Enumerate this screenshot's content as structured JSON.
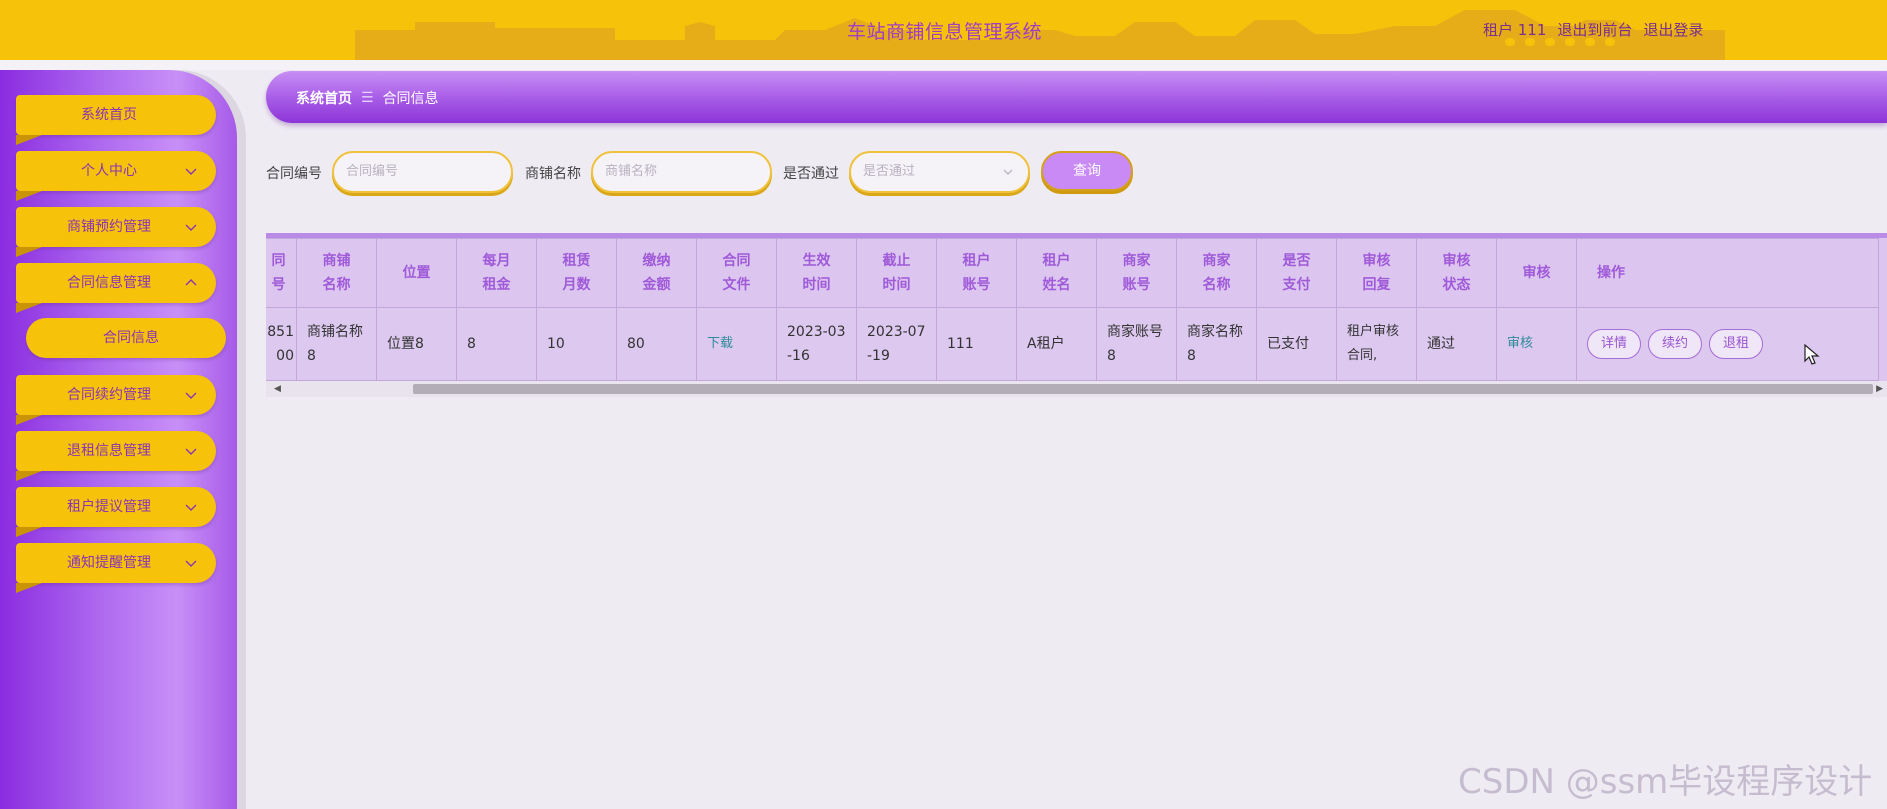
{
  "header": {
    "title": "车站商铺信息管理系统",
    "user": "租户 111",
    "to_front": "退出到前台",
    "logout": "退出登录"
  },
  "sidebar": {
    "items": [
      {
        "label": "系统首页",
        "expandable": false
      },
      {
        "label": "个人中心",
        "expandable": true
      },
      {
        "label": "商铺预约管理",
        "expandable": true
      },
      {
        "label": "合同信息管理",
        "expandable": true,
        "expanded": true
      },
      {
        "label": "合同续约管理",
        "expandable": true
      },
      {
        "label": "退租信息管理",
        "expandable": true
      },
      {
        "label": "租户提议管理",
        "expandable": true
      },
      {
        "label": "通知提醒管理",
        "expandable": true
      }
    ],
    "sub_item": "合同信息"
  },
  "breadcrumb": {
    "home": "系统首页",
    "sep": "☰",
    "current": "合同信息"
  },
  "search": {
    "contract_no_label": "合同编号",
    "contract_no_placeholder": "合同编号",
    "shop_name_label": "商铺名称",
    "shop_name_placeholder": "商铺名称",
    "approved_label": "是否通过",
    "approved_placeholder": "是否通过",
    "query_button": "查询"
  },
  "table": {
    "headers": [
      [
        "同",
        "号"
      ],
      [
        "商铺",
        "名称"
      ],
      [
        "位置",
        ""
      ],
      [
        "每月",
        "租金"
      ],
      [
        "租赁",
        "月数"
      ],
      [
        "缴纳",
        "金额"
      ],
      [
        "合同",
        "文件"
      ],
      [
        "生效",
        "时间"
      ],
      [
        "截止",
        "时间"
      ],
      [
        "租户",
        "账号"
      ],
      [
        "租户",
        "姓名"
      ],
      [
        "商家",
        "账号"
      ],
      [
        "商家",
        "名称"
      ],
      [
        "是否",
        "支付"
      ],
      [
        "审核",
        "回复"
      ],
      [
        "审核",
        "状态"
      ],
      [
        "审核",
        ""
      ],
      [
        "操作",
        ""
      ]
    ],
    "row": {
      "contract_no": [
        "851",
        "00"
      ],
      "shop_name": [
        "商铺名称",
        "8"
      ],
      "location": "位置8",
      "monthly_rent": "8",
      "months": "10",
      "amount": "80",
      "file": "下载",
      "start": [
        "2023-03",
        "-16"
      ],
      "end": [
        "2023-07",
        "-19"
      ],
      "tenant_account": "111",
      "tenant_name": "A租户",
      "merchant_account": [
        "商家账号",
        "8"
      ],
      "merchant_name": [
        "商家名称",
        "8"
      ],
      "paid": "已支付",
      "reply": [
        "租户审核",
        "合同,"
      ],
      "status": "通过",
      "audit": "审核",
      "actions": [
        "详情",
        "续约",
        "退租"
      ]
    }
  },
  "watermark": "CSDN @ssm毕设程序设计",
  "colors": {
    "header": "#f7c20a",
    "sidebar": "#a65ae8",
    "accent": "#c98af5",
    "background": "#efebf3"
  }
}
